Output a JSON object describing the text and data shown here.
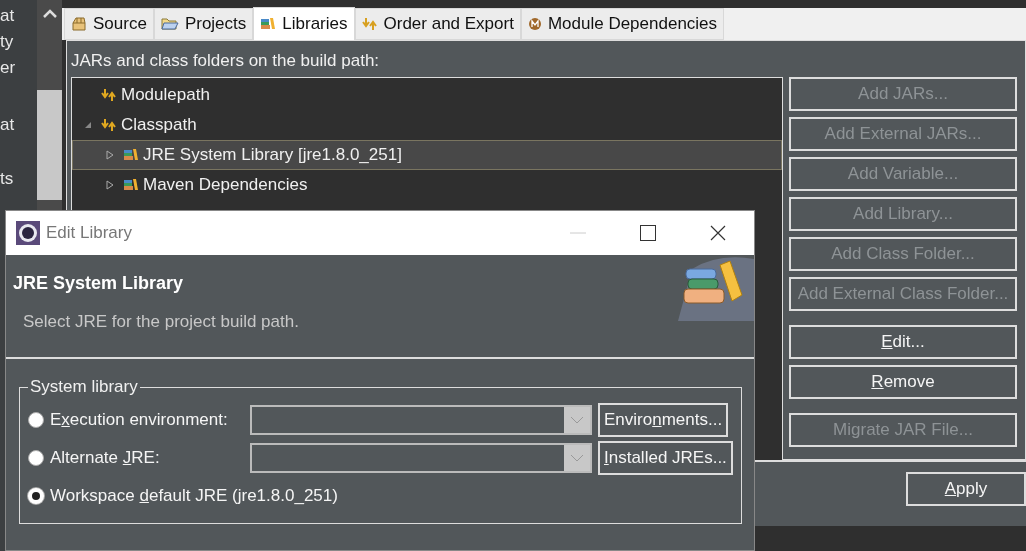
{
  "side_fragments": [
    "at",
    "ty",
    "er",
    "at",
    "ts"
  ],
  "tabs": [
    {
      "label": "Source",
      "selected": false
    },
    {
      "label": "Projects",
      "selected": false
    },
    {
      "label": "Libraries",
      "selected": true
    },
    {
      "label": "Order and Export",
      "selected": false
    },
    {
      "label": "Module Dependencies",
      "selected": false
    }
  ],
  "build_path_label": "JARs and class folders on the build path:",
  "tree": [
    {
      "label": "Modulepath",
      "kind": "path",
      "selected": false
    },
    {
      "label": "Classpath",
      "kind": "path",
      "expanded": true,
      "selected": false,
      "children": [
        {
          "label": "JRE System Library [jre1.8.0_251]",
          "kind": "library",
          "expanded": false,
          "selected": true
        },
        {
          "label": "Maven Dependencies",
          "kind": "library",
          "expanded": false,
          "selected": false
        }
      ]
    }
  ],
  "side_buttons": [
    {
      "label": [
        {
          "text": "Add JARs...",
          "underline": false
        }
      ],
      "disabled": true
    },
    {
      "label": [
        {
          "text": "Add External JARs...",
          "underline": false
        }
      ],
      "disabled": true
    },
    {
      "label": [
        {
          "text": "Add Variable...",
          "underline": false
        }
      ],
      "disabled": true
    },
    {
      "label": [
        {
          "text": "Add Library...",
          "underline": false
        }
      ],
      "disabled": true
    },
    {
      "label": [
        {
          "text": "Add Class Folder...",
          "underline": false
        }
      ],
      "disabled": true
    },
    {
      "label": [
        {
          "text": "Add External Class Folder...",
          "underline": false
        }
      ],
      "disabled": true
    },
    {
      "label": [
        {
          "text": "E",
          "underline": true
        },
        {
          "text": "dit...",
          "underline": false
        }
      ],
      "disabled": false
    },
    {
      "label": [
        {
          "text": "R",
          "underline": true
        },
        {
          "text": "emove",
          "underline": false
        }
      ],
      "disabled": false
    },
    {
      "label": [
        {
          "text": "Migrate JAR File...",
          "underline": false
        }
      ],
      "disabled": true
    }
  ],
  "apply_button": {
    "label": [
      {
        "text": "A",
        "underline": true
      },
      {
        "text": "pply",
        "underline": false
      }
    ]
  },
  "dialog": {
    "title": "Edit Library",
    "heading": "JRE System Library",
    "description": "Select JRE for the project build path.",
    "group_title": "System library",
    "options": [
      {
        "kind": "combo",
        "label": [
          {
            "text": "E",
            "underline": false
          },
          {
            "text": "x",
            "underline": true
          },
          {
            "text": "ecution environment:",
            "underline": false
          }
        ],
        "selected": false,
        "button": [
          {
            "text": "Enviro",
            "underline": false
          },
          {
            "text": "n",
            "underline": true
          },
          {
            "text": "ments...",
            "underline": false
          }
        ]
      },
      {
        "kind": "combo",
        "label": [
          {
            "text": "Alternate ",
            "underline": false
          },
          {
            "text": "J",
            "underline": true
          },
          {
            "text": "RE:",
            "underline": false
          }
        ],
        "selected": false,
        "button": [
          {
            "text": "I",
            "underline": true
          },
          {
            "text": "nstalled JREs...",
            "underline": false
          }
        ]
      },
      {
        "kind": "plain",
        "label": [
          {
            "text": "Workspace ",
            "underline": false
          },
          {
            "text": "d",
            "underline": true
          },
          {
            "text": "efault JRE (jre1.8.0_251)",
            "underline": false
          }
        ],
        "selected": true
      }
    ]
  }
}
